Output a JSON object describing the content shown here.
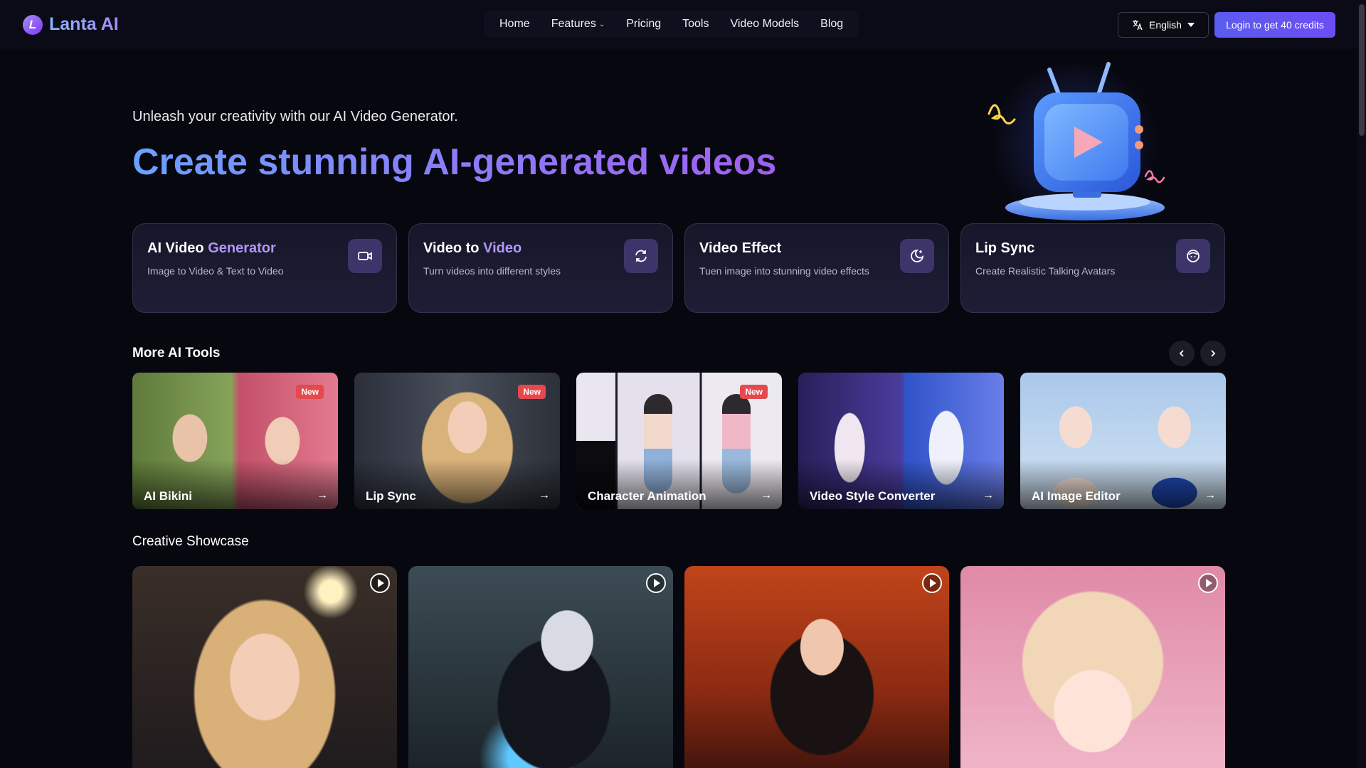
{
  "header": {
    "logo_letter": "L",
    "logo_text": "Lanta AI",
    "nav": [
      {
        "label": "Home"
      },
      {
        "label": "Features"
      },
      {
        "label": "Pricing"
      },
      {
        "label": "Tools"
      },
      {
        "label": "Video Models"
      },
      {
        "label": "Blog"
      }
    ],
    "language": "English",
    "login_label": "Login to get 40 credits"
  },
  "hero": {
    "subtitle": "Unleash your creativity with our AI Video Generator.",
    "title": "Create stunning AI-generated videos",
    "illustration_icon": "tv-play-icon"
  },
  "features": [
    {
      "title_a": "AI Video ",
      "title_b": "Generator",
      "desc": "Image to Video & Text to Video",
      "icon": "video-camera-icon"
    },
    {
      "title_a": "Video to ",
      "title_b": "Video",
      "desc": "Turn videos into different styles",
      "icon": "refresh-icon"
    },
    {
      "title_a": "Video Effect",
      "title_b": "",
      "desc": "Tuen image into stunning video effects",
      "icon": "magic-moon-icon"
    },
    {
      "title_a": "Lip Sync",
      "title_b": "",
      "desc": "Create Realistic Talking Avatars",
      "icon": "face-icon"
    }
  ],
  "more_tools": {
    "title": "More AI Tools",
    "badge": "New",
    "items": [
      {
        "label": "AI Bikini",
        "new": true,
        "arrow": "→"
      },
      {
        "label": "Lip Sync",
        "new": true,
        "arrow": "→"
      },
      {
        "label": "Character Animation",
        "new": true,
        "arrow": "→"
      },
      {
        "label": "Video Style Converter",
        "new": false,
        "arrow": "→"
      },
      {
        "label": "AI Image Editor",
        "new": false,
        "arrow": "→"
      }
    ]
  },
  "showcase": {
    "title": "Creative Showcase",
    "items": [
      {
        "name": "singer-portrait"
      },
      {
        "name": "warrior-android"
      },
      {
        "name": "demon-girl"
      },
      {
        "name": "anime-girl"
      }
    ]
  },
  "colors": {
    "background": "#07070f",
    "accent": "#6d4cf5",
    "badge": "#e5484d",
    "highlight": "#b197f6"
  }
}
